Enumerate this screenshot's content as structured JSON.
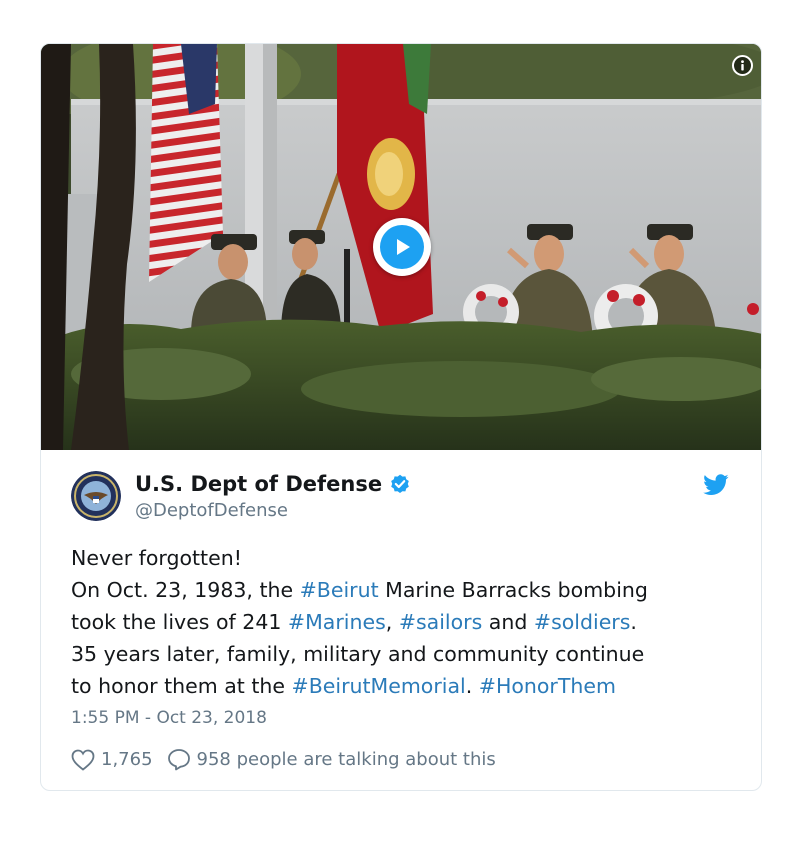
{
  "media": {
    "info_icon": "info-icon",
    "play_icon": "play-icon"
  },
  "author": {
    "display_name": "U.S. Dept of Defense",
    "handle": "@DeptofDefense",
    "verified_icon": "verified-badge-icon",
    "avatar_icon": "dod-seal"
  },
  "tweet": {
    "line1": "Never forgotten!",
    "line2_pre": "On Oct. 23, 1983, the ",
    "tag_beirut": "#Beirut",
    "line2_post": " Marine Barracks bombing",
    "line3_pre": "took the lives of 241 ",
    "tag_marines": "#Marines",
    "comma": ", ",
    "tag_sailors": "#sailors",
    "and": " and ",
    "tag_soldiers": "#soldiers",
    "period": ".",
    "line4": "35 years later, family, military and community continue",
    "line5_pre": "to honor them at the ",
    "tag_memorial": "#BeirutMemorial",
    "line5_mid": ". ",
    "tag_honor": "#HonorThem"
  },
  "timestamp": "1:55 PM - Oct 23, 2018",
  "actions": {
    "likes": "1,765",
    "talking": "958 people are talking about this",
    "heart_icon": "heart-icon",
    "comment_icon": "speech-bubble-icon"
  },
  "colors": {
    "link": "#2b7bb9",
    "twitter_blue": "#1da1f2",
    "text": "#14171a",
    "muted": "#657786"
  }
}
